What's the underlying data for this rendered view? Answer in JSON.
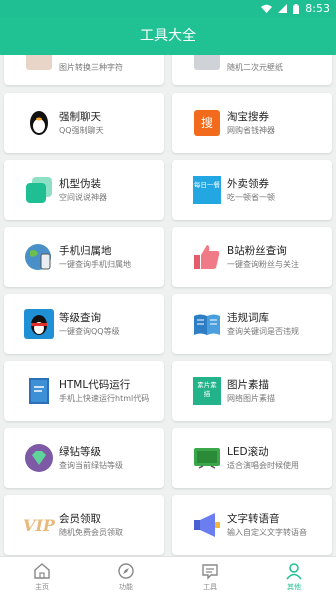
{
  "status": {
    "time": "8:53"
  },
  "header": {
    "title": "工具大全"
  },
  "tools": [
    {
      "title": "",
      "subtitle": "图片转换三种字符"
    },
    {
      "title": "",
      "subtitle": "随机二次元壁纸"
    },
    {
      "title": "强制聊天",
      "subtitle": "QQ强制聊天"
    },
    {
      "title": "淘宝搜券",
      "subtitle": "网购省钱神器",
      "icon_text": "搜"
    },
    {
      "title": "机型伪装",
      "subtitle": "空间说说神器"
    },
    {
      "title": "外卖领券",
      "subtitle": "吃一顿省一顿",
      "icon_text": "每日一餐"
    },
    {
      "title": "手机归属地",
      "subtitle": "一键查询手机归属地"
    },
    {
      "title": "B站粉丝查询",
      "subtitle": "一键查询粉丝与关注"
    },
    {
      "title": "等级查询",
      "subtitle": "一键查询QQ等级"
    },
    {
      "title": "违规词库",
      "subtitle": "查询关键词是否违规"
    },
    {
      "title": "HTML代码运行",
      "subtitle": "手机上快速运行html代码"
    },
    {
      "title": "图片素描",
      "subtitle": "网络图片素描",
      "icon_text": "素片素描"
    },
    {
      "title": "绿钻等级",
      "subtitle": "查询当前绿钻等级"
    },
    {
      "title": "LED滚动",
      "subtitle": "适合演唱会时候使用"
    },
    {
      "title": "会员领取",
      "subtitle": "随机免费会员领取",
      "icon_text": "VIP"
    },
    {
      "title": "文字转语音",
      "subtitle": "输入自定义文字转语音"
    }
  ],
  "tabs": [
    {
      "label": "主页",
      "icon": "home-icon"
    },
    {
      "label": "功能",
      "icon": "compass-icon"
    },
    {
      "label": "工具",
      "icon": "message-icon"
    },
    {
      "label": "其他",
      "icon": "person-icon",
      "active": true
    }
  ],
  "colors": {
    "accent": "#1fbf93"
  }
}
